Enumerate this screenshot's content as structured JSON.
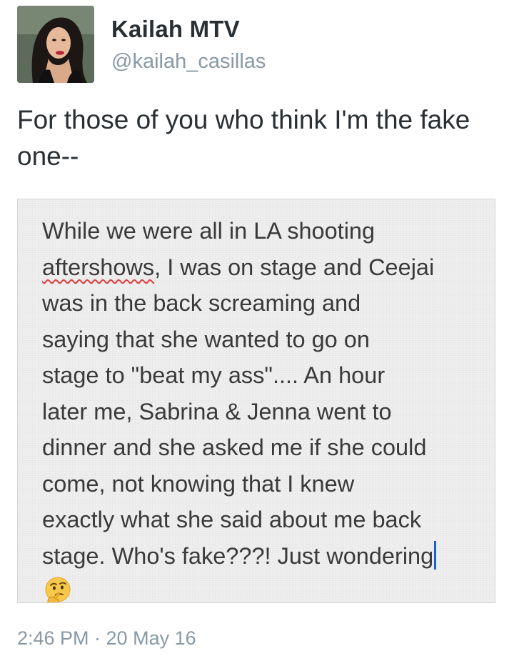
{
  "author": {
    "display_name": "Kailah MTV",
    "handle": "@kailah_casillas"
  },
  "tweet": {
    "text": "For those of you who think I'm the fake one--",
    "timestamp": "2:46 PM · 20 May 16"
  },
  "note_image": {
    "line_1": "While we were all in LA shooting",
    "misspelled_word": "aftershows",
    "line_2_rest": ", I was on stage and Ceejai",
    "line_3": "was in the back screaming and",
    "line_4": "saying that she wanted to go on",
    "line_5": "stage to \"beat my ass\".... An hour",
    "line_6": "later me, Sabrina & Jenna went to",
    "line_7": "dinner and she asked me if she could",
    "line_8": "come, not knowing that I knew",
    "line_9": "exactly what she said about me back",
    "line_10": "stage. Who's fake???! Just wondering",
    "emoji": "thinking-face"
  },
  "colors": {
    "text": "#292f33",
    "secondary": "#8899a6",
    "note_bg": "#efefef",
    "cursor": "#1a5fd8",
    "spellcheck": "#e03c3c"
  }
}
